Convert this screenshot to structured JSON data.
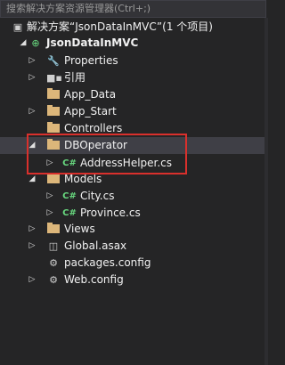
{
  "search": {
    "placeholder": "搜索解决方案资源管理器(Ctrl+;)"
  },
  "tree": {
    "solution": "解决方案“JsonDataInMVC”(1 个项目)",
    "project": "JsonDataInMVC",
    "properties": "Properties",
    "references": "引用",
    "app_data": "App_Data",
    "app_start": "App_Start",
    "controllers": "Controllers",
    "dboperator": "DBOperator",
    "addresshelper": "AddressHelper.cs",
    "models": "Models",
    "city": "City.cs",
    "province": "Province.cs",
    "views": "Views",
    "global": "Global.asax",
    "packages": "packages.config",
    "webconfig": "Web.config"
  },
  "icons": {
    "cs_glyph": "C#"
  },
  "colors": {
    "highlight": "#d9302c",
    "cs_icon": "#68d87f",
    "folder": "#dcb67a"
  }
}
